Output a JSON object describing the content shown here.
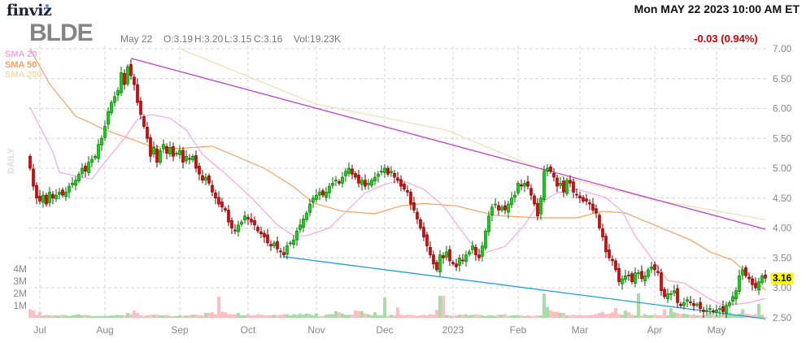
{
  "header": {
    "logo": "finviz",
    "ticker": "BLDE",
    "date_label": "May 22",
    "open": "O:3.19",
    "high": "H:3.20",
    "low": "L:3.15",
    "close": "C:3.16",
    "volume": "Vol:19.23K",
    "datetime": "Mon MAY 22 2023 10:00 AM ET",
    "change": "-0.03 (0.94%)",
    "timeframe": "DAILY"
  },
  "colors": {
    "up": "#00dd00",
    "down": "#ee0000",
    "up_vol": "#a8dca8",
    "down_vol": "#fcc0c0",
    "sma20": "#f4a6e4",
    "sma50": "#f8a060",
    "sma200": "#f2dcb0",
    "resistance": "#c040d0",
    "support": "#20a0e0",
    "last_badge": "#ffff00"
  },
  "chart_data": {
    "type": "candlestick",
    "title": "BLDE",
    "ylim": [
      2.5,
      7.0
    ],
    "y_ticks": [
      "7.00",
      "6.50",
      "6.00",
      "5.50",
      "5.00",
      "4.50",
      "4.00",
      "3.50",
      "3.00",
      "2.50"
    ],
    "volume_ticks": [
      "4M",
      "3M",
      "2M",
      "1M"
    ],
    "last_price": "3.16",
    "months": [
      {
        "label": "Jul",
        "index": 3
      },
      {
        "label": "Aug",
        "index": 23
      },
      {
        "label": "Sep",
        "index": 46
      },
      {
        "label": "Oct",
        "index": 67
      },
      {
        "label": "Nov",
        "index": 88
      },
      {
        "label": "Dec",
        "index": 109
      },
      {
        "label": "2023",
        "index": 130
      },
      {
        "label": "Feb",
        "index": 150
      },
      {
        "label": "Mar",
        "index": 169
      },
      {
        "label": "Apr",
        "index": 192
      },
      {
        "label": "May",
        "index": 211
      }
    ],
    "legend": [
      "SMA 20",
      "SMA 50",
      "SMA 200"
    ],
    "closes": [
      5.0,
      4.7,
      4.5,
      4.45,
      4.55,
      4.4,
      4.6,
      4.5,
      4.55,
      4.6,
      4.55,
      4.6,
      4.7,
      4.75,
      4.8,
      4.9,
      5.0,
      4.95,
      5.1,
      5.15,
      5.2,
      5.4,
      5.5,
      5.7,
      5.95,
      6.1,
      6.2,
      6.3,
      6.6,
      6.4,
      6.7,
      6.55,
      6.4,
      6.1,
      5.9,
      5.7,
      5.5,
      5.2,
      5.35,
      5.1,
      5.3,
      5.4,
      5.25,
      5.35,
      5.2,
      5.25,
      5.3,
      5.1,
      5.2,
      5.15,
      5.2,
      5.0,
      4.9,
      4.8,
      4.85,
      4.75,
      4.6,
      4.5,
      4.4,
      4.35,
      4.3,
      4.1,
      4.0,
      3.95,
      4.05,
      4.1,
      4.2,
      4.15,
      4.1,
      4.05,
      3.95,
      3.9,
      3.85,
      3.75,
      3.7,
      3.75,
      3.65,
      3.6,
      3.55,
      3.7,
      3.75,
      3.8,
      3.95,
      4.05,
      4.15,
      4.25,
      4.4,
      4.5,
      4.55,
      4.6,
      4.55,
      4.6,
      4.7,
      4.75,
      4.8,
      4.75,
      4.85,
      4.95,
      5.0,
      4.9,
      4.85,
      4.75,
      4.8,
      4.7,
      4.75,
      4.8,
      4.85,
      4.9,
      4.95,
      5.0,
      4.9,
      4.95,
      4.85,
      4.8,
      4.7,
      4.65,
      4.6,
      4.4,
      4.3,
      4.15,
      4.0,
      3.85,
      3.7,
      3.55,
      3.4,
      3.3,
      3.55,
      3.5,
      3.6,
      3.45,
      3.4,
      3.35,
      3.5,
      3.45,
      3.55,
      3.6,
      3.7,
      3.55,
      3.5,
      3.7,
      3.95,
      4.2,
      4.35,
      4.4,
      4.3,
      4.35,
      4.3,
      4.4,
      4.5,
      4.55,
      4.75,
      4.7,
      4.75,
      4.7,
      4.55,
      4.4,
      4.2,
      4.5,
      4.95,
      5.0,
      4.95,
      4.85,
      4.7,
      4.75,
      4.6,
      4.8,
      4.75,
      4.6,
      4.55,
      4.5,
      4.45,
      4.45,
      4.4,
      4.3,
      4.25,
      4.0,
      3.85,
      3.6,
      3.5,
      3.45,
      3.3,
      3.1,
      3.15,
      3.2,
      3.2,
      3.1,
      3.25,
      3.25,
      3.15,
      3.2,
      3.3,
      3.35,
      3.3,
      3.25,
      2.95,
      2.85,
      2.9,
      2.9,
      2.95,
      2.75,
      2.7,
      2.75,
      2.8,
      2.75,
      2.7,
      2.72,
      2.65,
      2.6,
      2.62,
      2.65,
      2.6,
      2.63,
      2.65,
      2.6,
      2.7,
      2.75,
      2.85,
      2.95,
      3.2,
      3.3,
      3.2,
      3.15,
      3.05,
      3.0,
      3.1,
      3.2,
      3.16
    ],
    "volumes_k": [
      700,
      600,
      250,
      500,
      180,
      250,
      200,
      220,
      200,
      180,
      250,
      200,
      150,
      200,
      250,
      300,
      200,
      250,
      200,
      150,
      150,
      150,
      150,
      150,
      150,
      200,
      200,
      250,
      200,
      200,
      400,
      300,
      600,
      400,
      200,
      150,
      200,
      250,
      250,
      250,
      200,
      200,
      250,
      150,
      150,
      150,
      200,
      150,
      200,
      200,
      250,
      250,
      200,
      200,
      400,
      400,
      450,
      300,
      1750,
      500,
      450,
      300,
      300,
      300,
      400,
      200,
      200,
      300,
      200,
      200,
      300,
      250,
      200,
      200,
      200,
      250,
      200,
      250,
      300,
      300,
      200,
      300,
      250,
      350,
      250,
      350,
      300,
      200,
      350,
      100,
      150,
      250,
      300,
      300,
      550,
      450,
      350,
      250,
      250,
      250,
      600,
      550,
      550,
      350,
      300,
      200,
      450,
      200,
      200,
      1650,
      150,
      250,
      200,
      850,
      250,
      200,
      250,
      250,
      200,
      150,
      200,
      250,
      200,
      300,
      250,
      650,
      1800,
      1800,
      250,
      200,
      150,
      200,
      250,
      250,
      300,
      200,
      250,
      300,
      250,
      200,
      150,
      200,
      200,
      150,
      250,
      250,
      300,
      150,
      200,
      200,
      200,
      200,
      150,
      200,
      150,
      150,
      200,
      200,
      2000,
      900,
      600,
      500,
      500,
      400,
      400,
      200,
      200,
      250,
      200,
      200,
      200,
      200,
      200,
      250,
      300,
      400,
      500,
      300,
      350,
      450,
      800,
      300,
      250,
      600,
      450,
      250,
      200,
      2000,
      200,
      300,
      200,
      200,
      250,
      200,
      200,
      700,
      200,
      800,
      450,
      400,
      300,
      350,
      300,
      250,
      300,
      200,
      200,
      200,
      250,
      400,
      300,
      200,
      250,
      300,
      300,
      450,
      250,
      250,
      350,
      700,
      350,
      300,
      200,
      300,
      1150,
      250,
      100
    ],
    "sma20": [
      [
        0,
        6.02
      ],
      [
        7,
        5.27
      ],
      [
        9,
        4.93
      ],
      [
        15,
        4.86
      ],
      [
        19,
        4.82
      ],
      [
        23,
        5.1
      ],
      [
        29,
        5.5
      ],
      [
        33,
        5.82
      ],
      [
        37,
        5.9
      ],
      [
        43,
        5.84
      ],
      [
        48,
        5.64
      ],
      [
        53,
        5.23
      ],
      [
        58,
        5.0
      ],
      [
        59,
        4.96
      ],
      [
        68,
        4.51
      ],
      [
        76,
        4.05
      ],
      [
        81,
        3.87
      ],
      [
        85,
        3.87
      ],
      [
        92,
        4.0
      ],
      [
        98,
        4.32
      ],
      [
        103,
        4.59
      ],
      [
        109,
        4.73
      ],
      [
        114,
        4.8
      ],
      [
        121,
        4.65
      ],
      [
        127,
        4.37
      ],
      [
        135,
        3.78
      ],
      [
        139,
        3.57
      ],
      [
        146,
        3.69
      ],
      [
        152,
        4.05
      ],
      [
        156,
        4.39
      ],
      [
        162,
        4.59
      ],
      [
        168,
        4.65
      ],
      [
        177,
        4.51
      ],
      [
        182,
        4.28
      ],
      [
        186,
        3.87
      ],
      [
        191,
        3.5
      ],
      [
        196,
        3.12
      ],
      [
        201,
        3.08
      ],
      [
        209,
        2.81
      ],
      [
        213,
        2.71
      ],
      [
        220,
        2.74
      ],
      [
        226,
        2.82
      ]
    ],
    "sma50": [
      [
        0,
        7.0
      ],
      [
        6,
        6.41
      ],
      [
        14,
        5.87
      ],
      [
        19,
        5.75
      ],
      [
        23,
        5.64
      ],
      [
        29,
        5.53
      ],
      [
        37,
        5.37
      ],
      [
        46,
        5.33
      ],
      [
        56,
        5.37
      ],
      [
        72,
        5.0
      ],
      [
        81,
        4.69
      ],
      [
        87,
        4.42
      ],
      [
        96,
        4.28
      ],
      [
        106,
        4.24
      ],
      [
        114,
        4.37
      ],
      [
        121,
        4.41
      ],
      [
        131,
        4.37
      ],
      [
        143,
        4.21
      ],
      [
        156,
        4.17
      ],
      [
        168,
        4.17
      ],
      [
        176,
        4.28
      ],
      [
        183,
        4.25
      ],
      [
        191,
        4.07
      ],
      [
        203,
        3.8
      ],
      [
        209,
        3.6
      ],
      [
        216,
        3.46
      ],
      [
        226,
        2.96
      ]
    ],
    "sma200": [
      [
        46,
        7.0
      ],
      [
        88,
        6.07
      ],
      [
        128,
        5.64
      ],
      [
        161,
        4.89
      ],
      [
        191,
        4.48
      ],
      [
        226,
        4.14
      ]
    ],
    "trendlines": [
      {
        "name": "resistance",
        "from": [
          31,
          6.84
        ],
        "to": [
          226,
          3.98
        ]
      },
      {
        "name": "support",
        "from": [
          78,
          3.52
        ],
        "to": [
          226,
          2.48
        ]
      }
    ]
  }
}
